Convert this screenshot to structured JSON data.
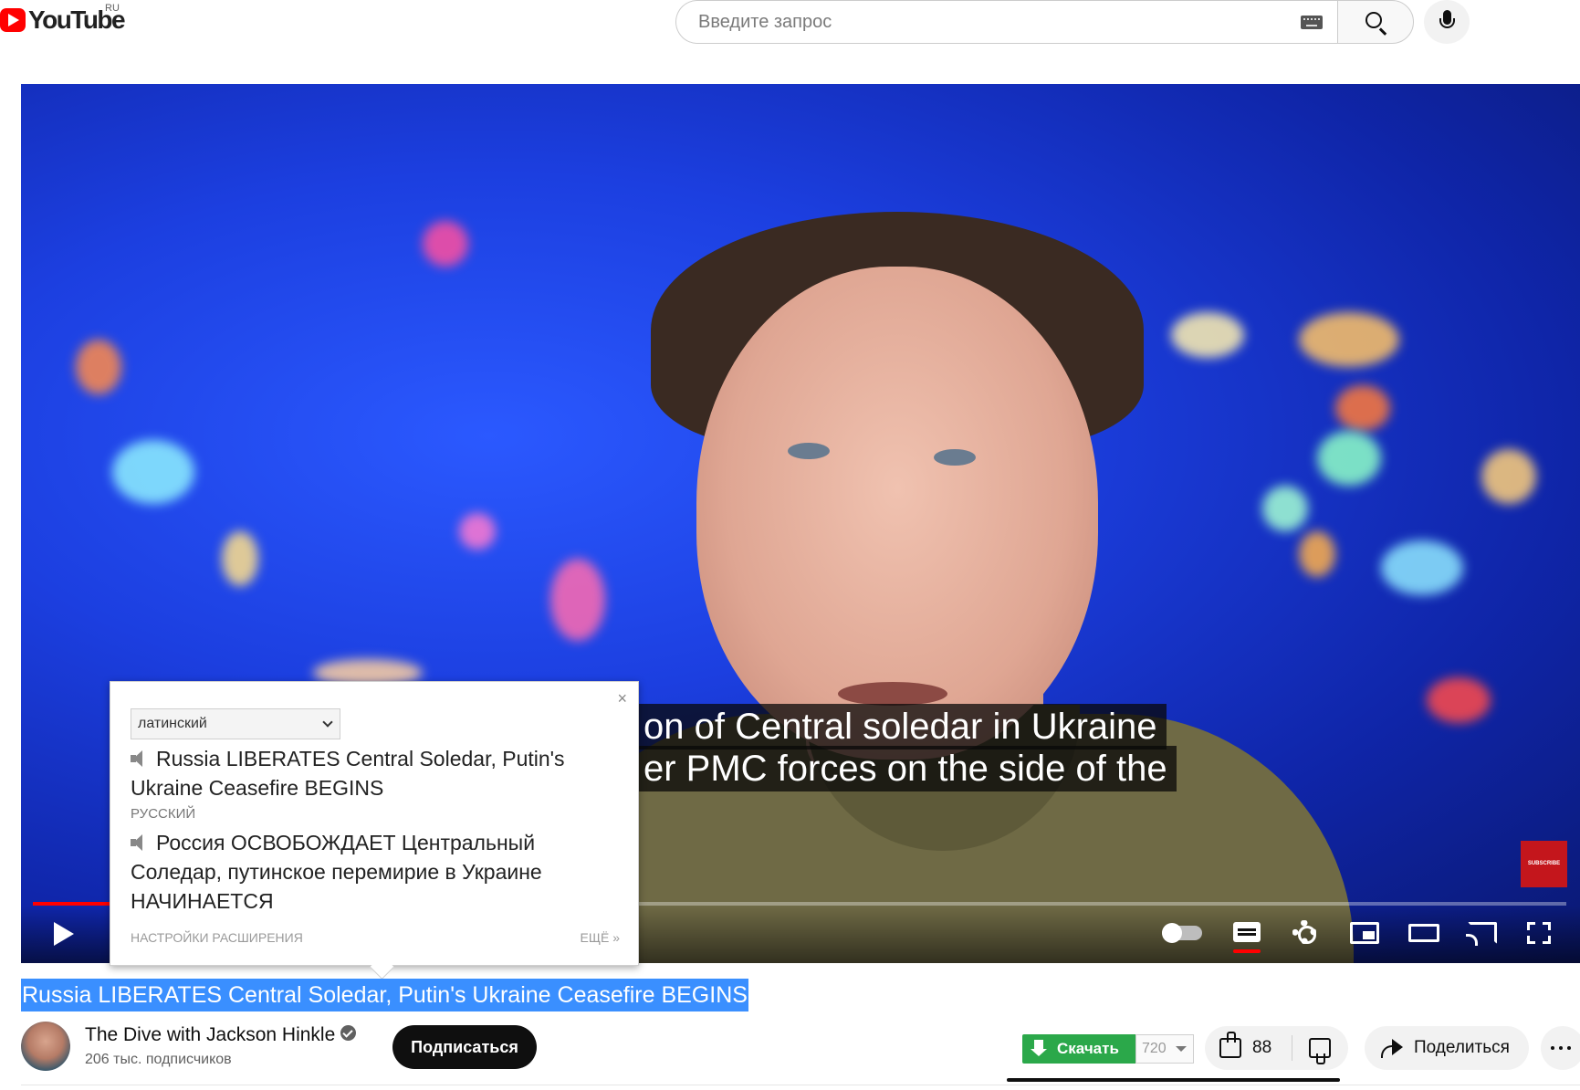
{
  "masthead": {
    "logo_text": "YouTube",
    "region": "RU",
    "search_placeholder": "Введите запрос",
    "icons": [
      "keyboard-icon",
      "search-icon",
      "microphone-icon"
    ]
  },
  "player": {
    "captions": [
      "on of Central soledar in Ukraine",
      "er PMC forces on the side of the"
    ],
    "end_screen_badge": "SUBSCRIBE",
    "progress_fraction": 0.05,
    "colors": {
      "progress": "#ff0000",
      "background": "#1c3fe0"
    },
    "controls": [
      "play-icon",
      "autoplay-toggle-icon",
      "subtitles-icon",
      "settings-gear-icon",
      "miniplayer-icon",
      "theater-mode-icon",
      "cast-icon",
      "fullscreen-icon"
    ]
  },
  "translator_popup": {
    "close_symbol": "×",
    "language_selected": "латинский",
    "source_text": "Russia LIBERATES Central Soledar, Putin's Ukraine Ceasefire BEGINS",
    "target_label": "РУССКИЙ",
    "target_text": "Россия ОСВОБОЖДАЕТ Центральный Соледар, путинское перемирие в Украине НАЧИНАЕТСЯ",
    "settings_link": "НАСТРОЙКИ РАСШИРЕНИЯ",
    "more_link": "ЕЩЁ »"
  },
  "video": {
    "title": "Russia LIBERATES Central Soledar, Putin's Ukraine Ceasefire BEGINS",
    "title_highlight_color": "#3a8fff"
  },
  "channel": {
    "name": "The Dive with Jackson Hinkle",
    "verified": true,
    "subscribers": "206 тыс. подписчиков",
    "subscribe_label": "Подписаться"
  },
  "actions": {
    "download_label": "Скачать",
    "quality": "720",
    "like_count": "88",
    "share_label": "Поделиться",
    "download_color": "#2ba84a"
  }
}
